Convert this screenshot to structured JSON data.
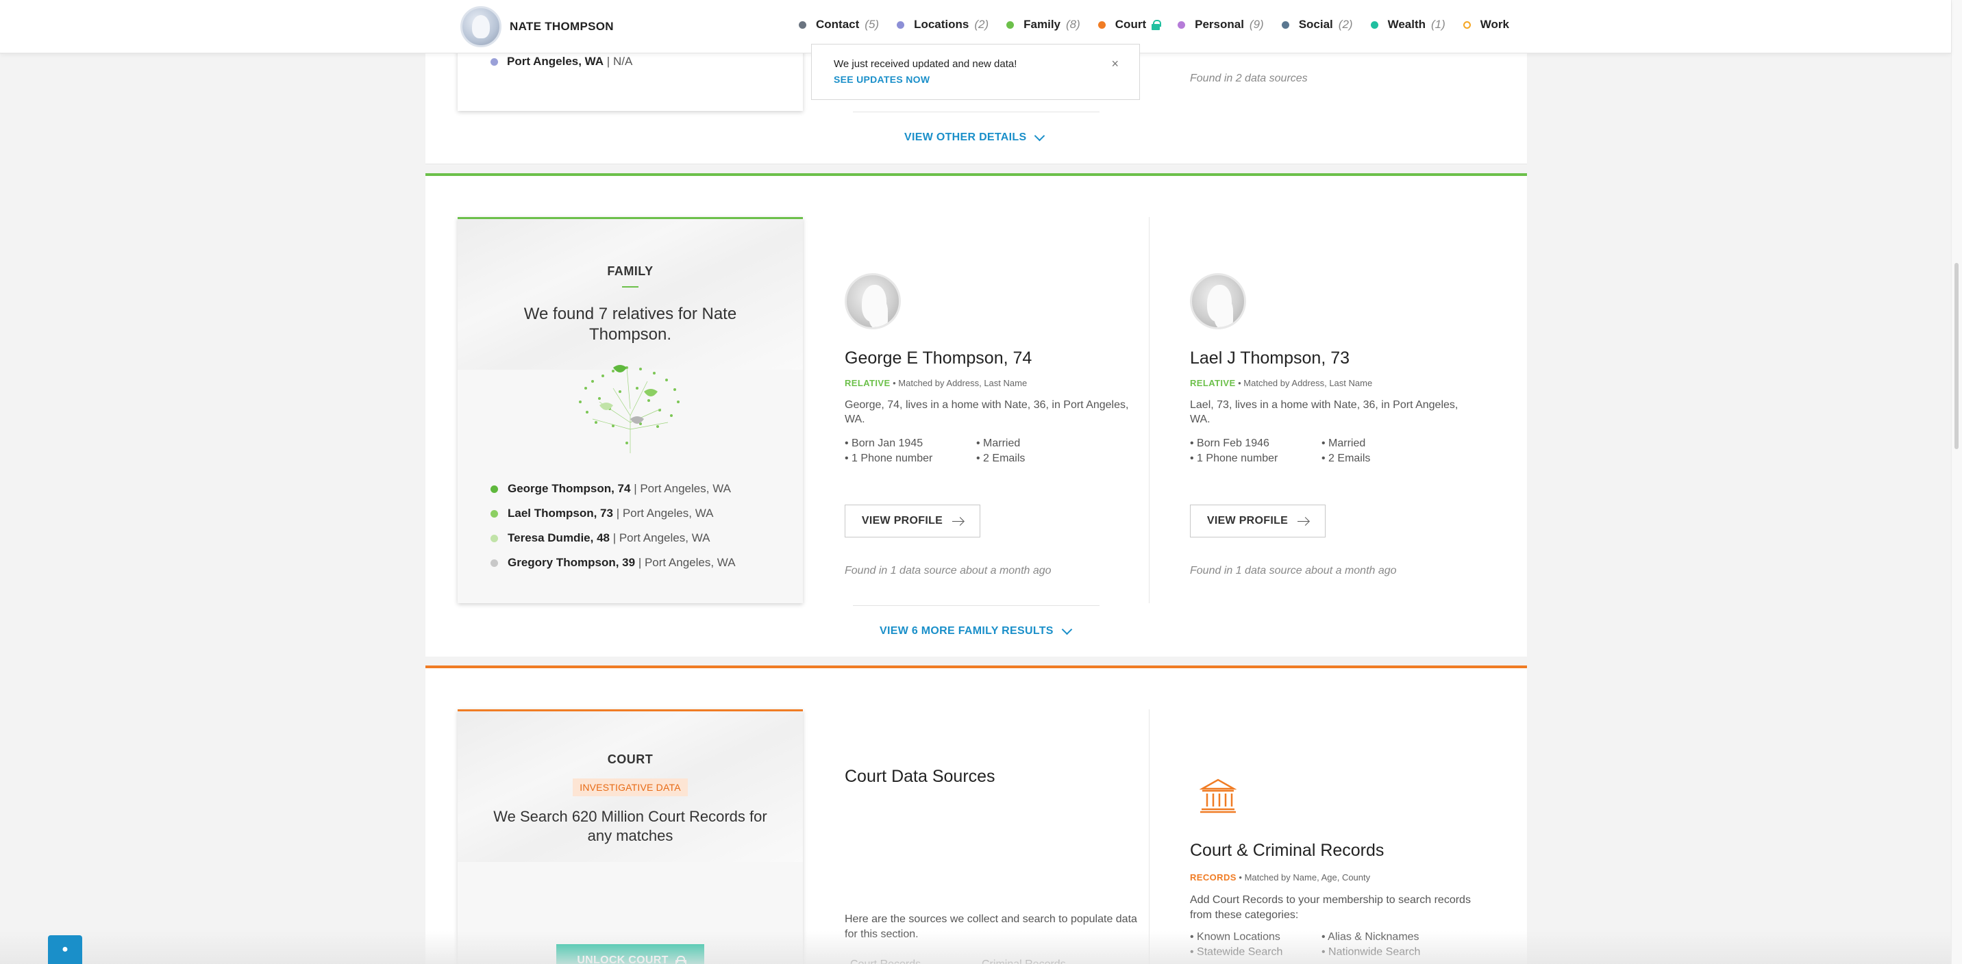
{
  "header": {
    "name": "NATE THOMPSON",
    "nav": [
      {
        "label": "Contact",
        "count": "(5)",
        "color": "#6b7480"
      },
      {
        "label": "Locations",
        "count": "(2)",
        "color": "#8c8fd6"
      },
      {
        "label": "Family",
        "count": "(8)",
        "color": "#6cc04a"
      },
      {
        "label": "Court",
        "count": "",
        "color": "#f07c24",
        "locked": true
      },
      {
        "label": "Personal",
        "count": "(9)",
        "color": "#b57bd8"
      },
      {
        "label": "Social",
        "count": "(2)",
        "color": "#5a7790"
      },
      {
        "label": "Wealth",
        "count": "(1)",
        "color": "#1fbf9f"
      },
      {
        "label": "Work",
        "count": "",
        "color": "#f5a623",
        "hollow": true
      }
    ]
  },
  "notice": {
    "message": "We just received updated and new data!",
    "link": "SEE UPDATES NOW",
    "close": "×"
  },
  "locations_section": {
    "location_city": "Port Angeles, WA",
    "location_sep": " | ",
    "location_detail": "N/A",
    "found": "Found in 2 data sources",
    "view_other": "VIEW OTHER DETAILS"
  },
  "family_section": {
    "title": "FAMILY",
    "headline": "We found 7 relatives for Nate Thompson.",
    "relatives": [
      {
        "name": "George Thompson, 74",
        "place": " | Port Angeles, WA",
        "color": "#5fb83d"
      },
      {
        "name": "Lael Thompson, 73",
        "place": " | Port Angeles, WA",
        "color": "#8ccf63"
      },
      {
        "name": "Teresa Dumdie, 48",
        "place": " | Port Angeles, WA",
        "color": "#c1e3a8"
      },
      {
        "name": "Gregory Thompson, 39",
        "place": " | Port Angeles, WA",
        "color": "#c8c8c8"
      }
    ],
    "people": [
      {
        "name": "George E Thompson, 74",
        "tag": "RELATIVE",
        "match": " • Matched by Address, Last Name",
        "desc": "George, 74, lives in a home with Nate, 36, in Port Angeles, WA.",
        "facts": [
          "• Born Jan 1945",
          "• Married",
          "• 1 Phone number",
          "• 2 Emails"
        ],
        "button": "VIEW PROFILE",
        "found": "Found in 1 data source about a month ago"
      },
      {
        "name": "Lael J Thompson, 73",
        "tag": "RELATIVE",
        "match": " • Matched by Address, Last Name",
        "desc": "Lael, 73, lives in a home with Nate, 36, in Port Angeles, WA.",
        "facts": [
          "• Born Feb 1946",
          "• Married",
          "• 1 Phone number",
          "• 2 Emails"
        ],
        "button": "VIEW PROFILE",
        "found": "Found in 1 data source about a month ago"
      }
    ],
    "view_more": "VIEW 6 MORE FAMILY RESULTS"
  },
  "court_section": {
    "title": "COURT",
    "badge": "INVESTIGATIVE DATA",
    "headline": "We Search 620 Million Court Records for any matches",
    "unlock": "UNLOCK COURT",
    "sources_title": "Court Data Sources",
    "sources_desc": "Here are the sources we collect and search to populate data for this section.",
    "sources_cut": [
      "Court Records",
      "Criminal Records"
    ],
    "records_title": "Court & Criminal Records",
    "records_tag": "RECORDS",
    "records_match": " • Matched by Name, Age, County",
    "records_desc": "Add Court Records to your membership to search records from these categories:",
    "categories": [
      "• Known Locations",
      "• Alias & Nicknames",
      "• Statewide Search",
      "• Nationwide Search"
    ]
  },
  "colors": {
    "family_green": "#6cc04a",
    "court_orange": "#f07c24",
    "link_blue": "#1a8fc9",
    "unlock_teal": "#1fbf9f"
  }
}
